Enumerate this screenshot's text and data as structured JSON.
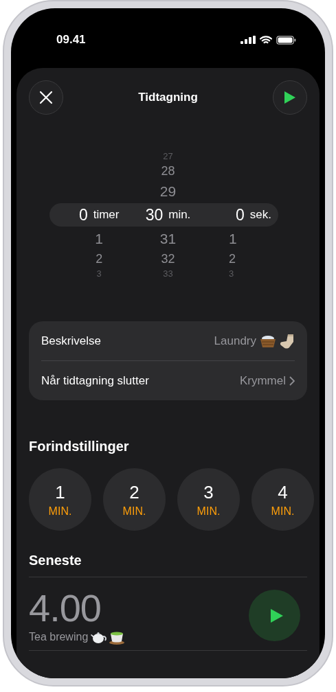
{
  "status_bar": {
    "time": "09.41"
  },
  "header": {
    "title": "Tidtagning"
  },
  "picker": {
    "columns": [
      {
        "selected": "0",
        "unit": "timer",
        "below": [
          "1",
          "2",
          "3"
        ]
      },
      {
        "above": [
          "27",
          "28",
          "29"
        ],
        "selected": "30",
        "unit": "min.",
        "below": [
          "31",
          "32",
          "33"
        ]
      },
      {
        "selected": "0",
        "unit": "sek.",
        "below": [
          "1",
          "2",
          "3"
        ]
      }
    ]
  },
  "settings": [
    {
      "kind": "text",
      "label": "Beskrivelse",
      "value": "Laundry"
    },
    {
      "kind": "link",
      "label": "Når tidtagning slutter",
      "value": "Krymmel"
    }
  ],
  "presets": {
    "title": "Forindstillinger",
    "items": [
      {
        "number": "1",
        "unit": "MIN."
      },
      {
        "number": "2",
        "unit": "MIN."
      },
      {
        "number": "3",
        "unit": "MIN."
      },
      {
        "number": "4",
        "unit": "MIN."
      }
    ]
  },
  "recent": {
    "title": "Seneste",
    "items": [
      {
        "time": "4.00",
        "label": "Tea brewing"
      }
    ]
  }
}
